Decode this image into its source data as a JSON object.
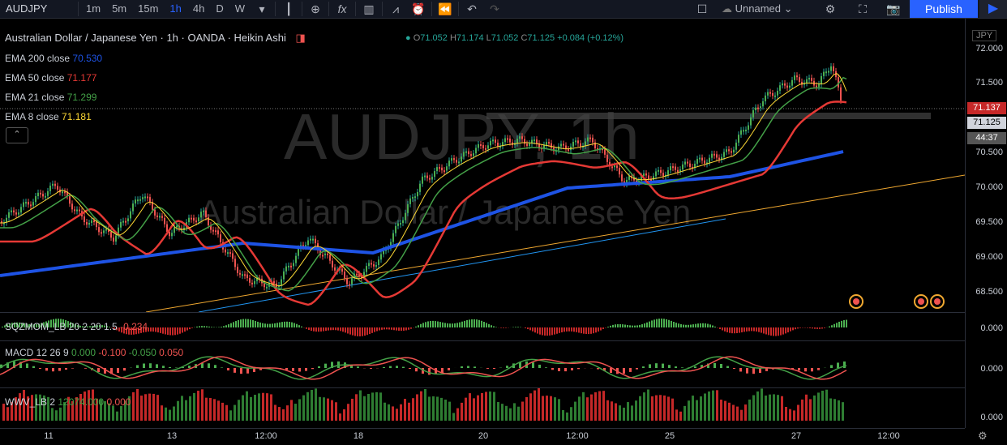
{
  "toolbar": {
    "symbol": "AUDJPY",
    "intervals": [
      "1m",
      "5m",
      "15m",
      "1h",
      "4h",
      "D",
      "W"
    ],
    "active_interval": "1h",
    "layout_name": "Unnamed",
    "publish": "Publish"
  },
  "legend": {
    "title": "Australian Dollar / Japanese Yen · 1h · OANDA · Heikin Ashi",
    "ohlc": {
      "o": "71.052",
      "h": "71.174",
      "l": "71.052",
      "c": "71.125",
      "chg": "+0.084 (+0.12%)"
    }
  },
  "indicators": [
    {
      "name": "EMA 200 close",
      "value": "70.530",
      "color": "#1e53e5"
    },
    {
      "name": "EMA 50 close",
      "value": "71.177",
      "color": "#e53935"
    },
    {
      "name": "EMA 21 close",
      "value": "71.299",
      "color": "#43a047"
    },
    {
      "name": "EMA 8 close",
      "value": "71.181",
      "color": "#fdd835"
    }
  ],
  "watermark": {
    "symbol": "AUDJPY, 1h",
    "name": "Australian Dollar / Japanese Yen"
  },
  "panes": {
    "sqz": {
      "label": "SQZMOM_LB 20 2 20 1.5",
      "value": "-0.234",
      "axis": "0.000"
    },
    "macd": {
      "label": "MACD 12 26 9",
      "v1": "0.000",
      "v2": "-0.100",
      "v3": "-0.050",
      "v4": "0.050",
      "axis": "0.000"
    },
    "wwv": {
      "label": "WWV_LB 2",
      "v1": "12074.000",
      "v2": "0.000",
      "axis": "0.000"
    }
  },
  "price_axis": {
    "currency": "JPY",
    "labels": [
      "72.000",
      "71.500",
      "71.000",
      "70.500",
      "70.000",
      "69.500",
      "69.000",
      "68.500"
    ],
    "tag_ema": "71.137",
    "tag_price": "71.125",
    "countdown": "44:37"
  },
  "time_axis": [
    "11",
    "13",
    "12:00",
    "18",
    "20",
    "12:00",
    "25",
    "27",
    "12:00"
  ],
  "events": [
    "4",
    "12",
    "3"
  ],
  "colors": {
    "bull": "#26a69a",
    "bear": "#ef5350",
    "accent": "#2962ff"
  }
}
